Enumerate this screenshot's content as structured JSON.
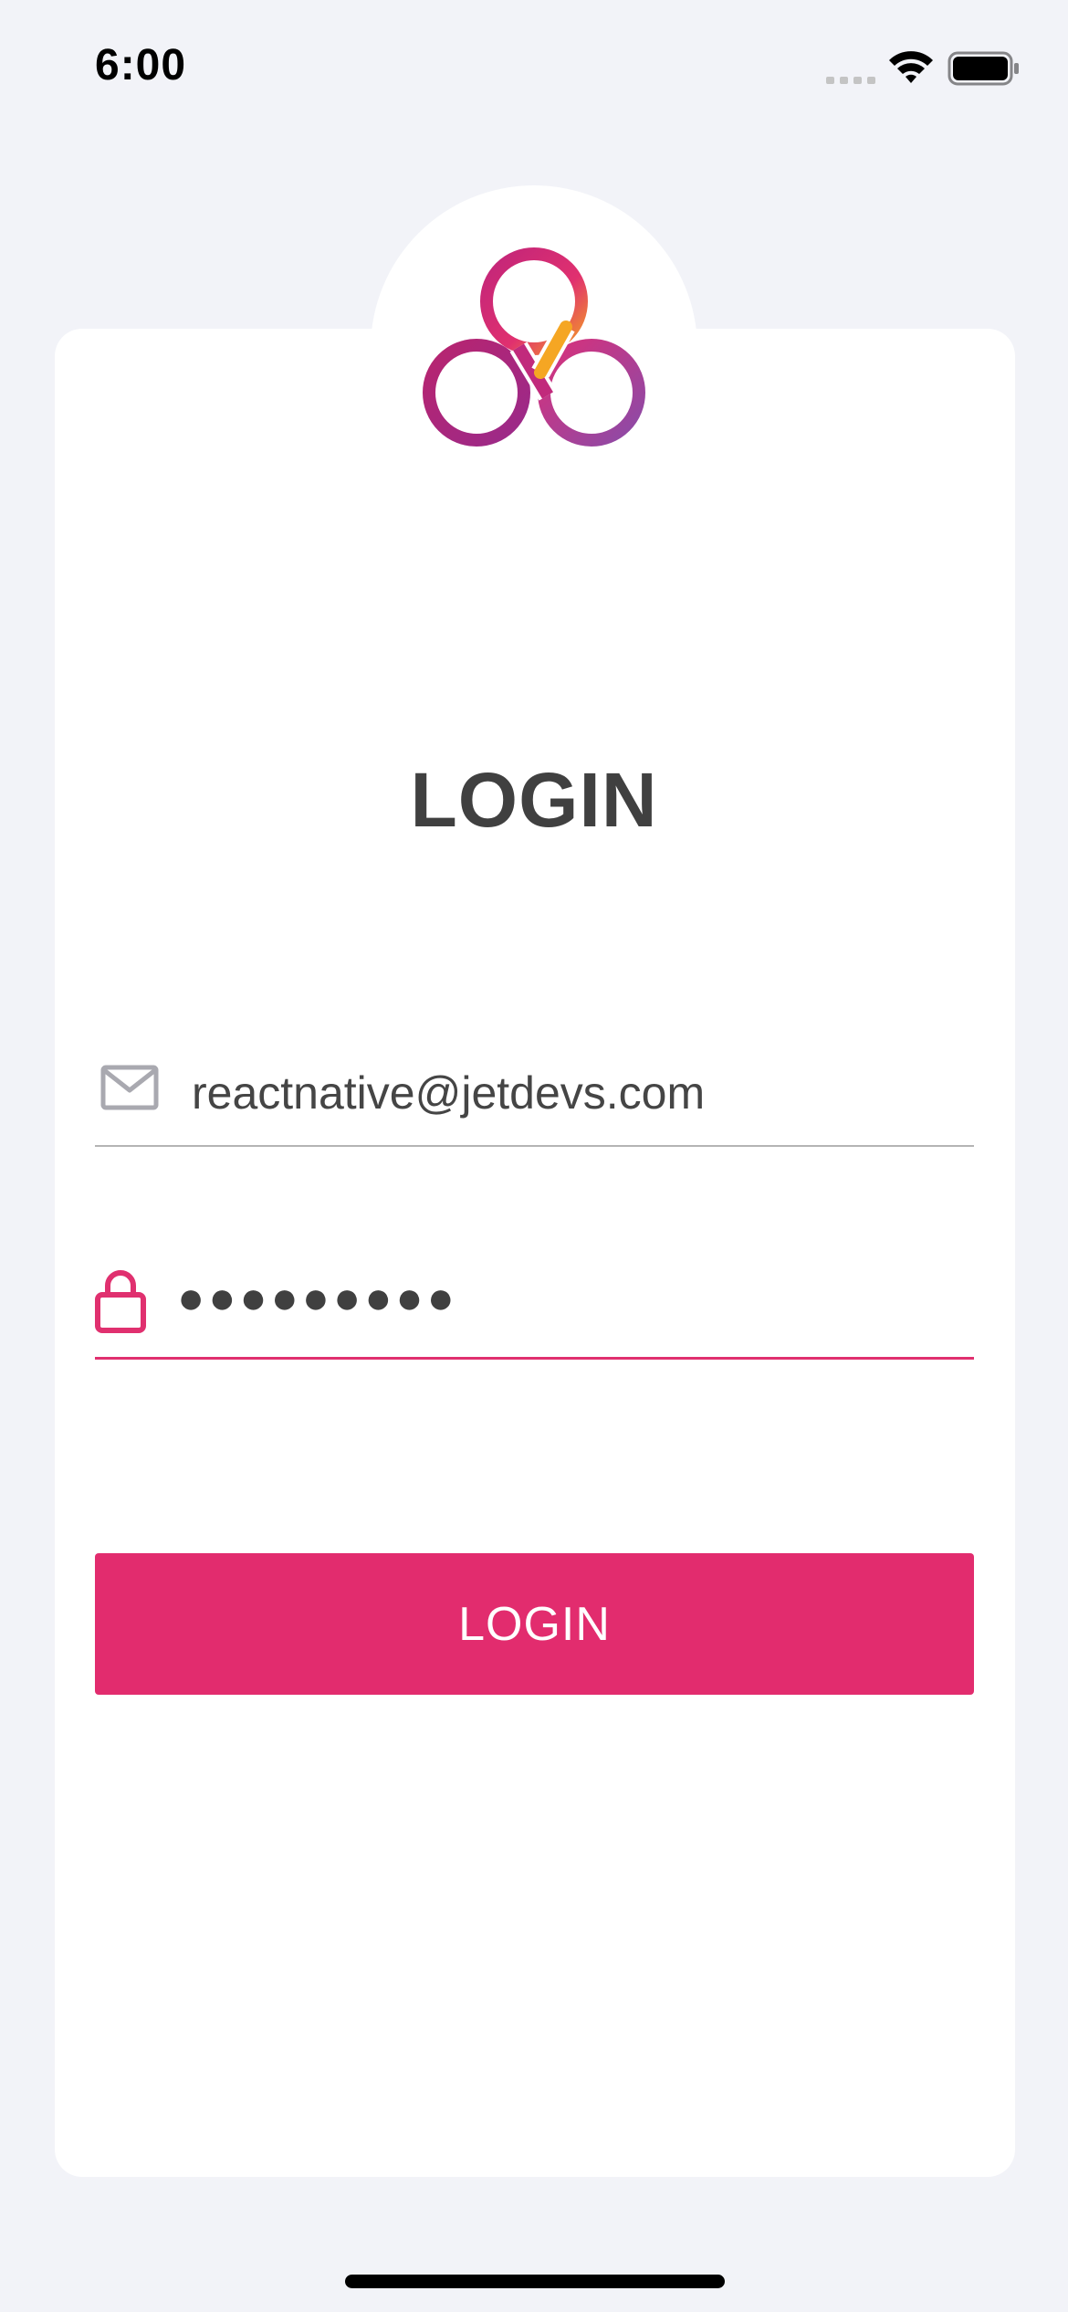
{
  "status_bar": {
    "time": "6:00",
    "icons": [
      "signal-icon",
      "wifi-icon",
      "battery-icon"
    ]
  },
  "logo": {
    "icon": "trefoil-logo",
    "colors": [
      "#c1257a",
      "#e0306f",
      "#f39c26",
      "#8a4ba8"
    ]
  },
  "login": {
    "title": "LOGIN",
    "email": {
      "icon": "mail-icon",
      "value": "reactnative@jetdevs.com"
    },
    "password": {
      "icon": "lock-icon",
      "masked_value": "●●●●●●●●●"
    },
    "button_label": "LOGIN"
  },
  "colors": {
    "background": "#f2f3f8",
    "card": "#ffffff",
    "accent": "#e22c6e",
    "title_text": "#404040",
    "field_text": "#454545",
    "inactive_underline": "#b4b4b4"
  }
}
